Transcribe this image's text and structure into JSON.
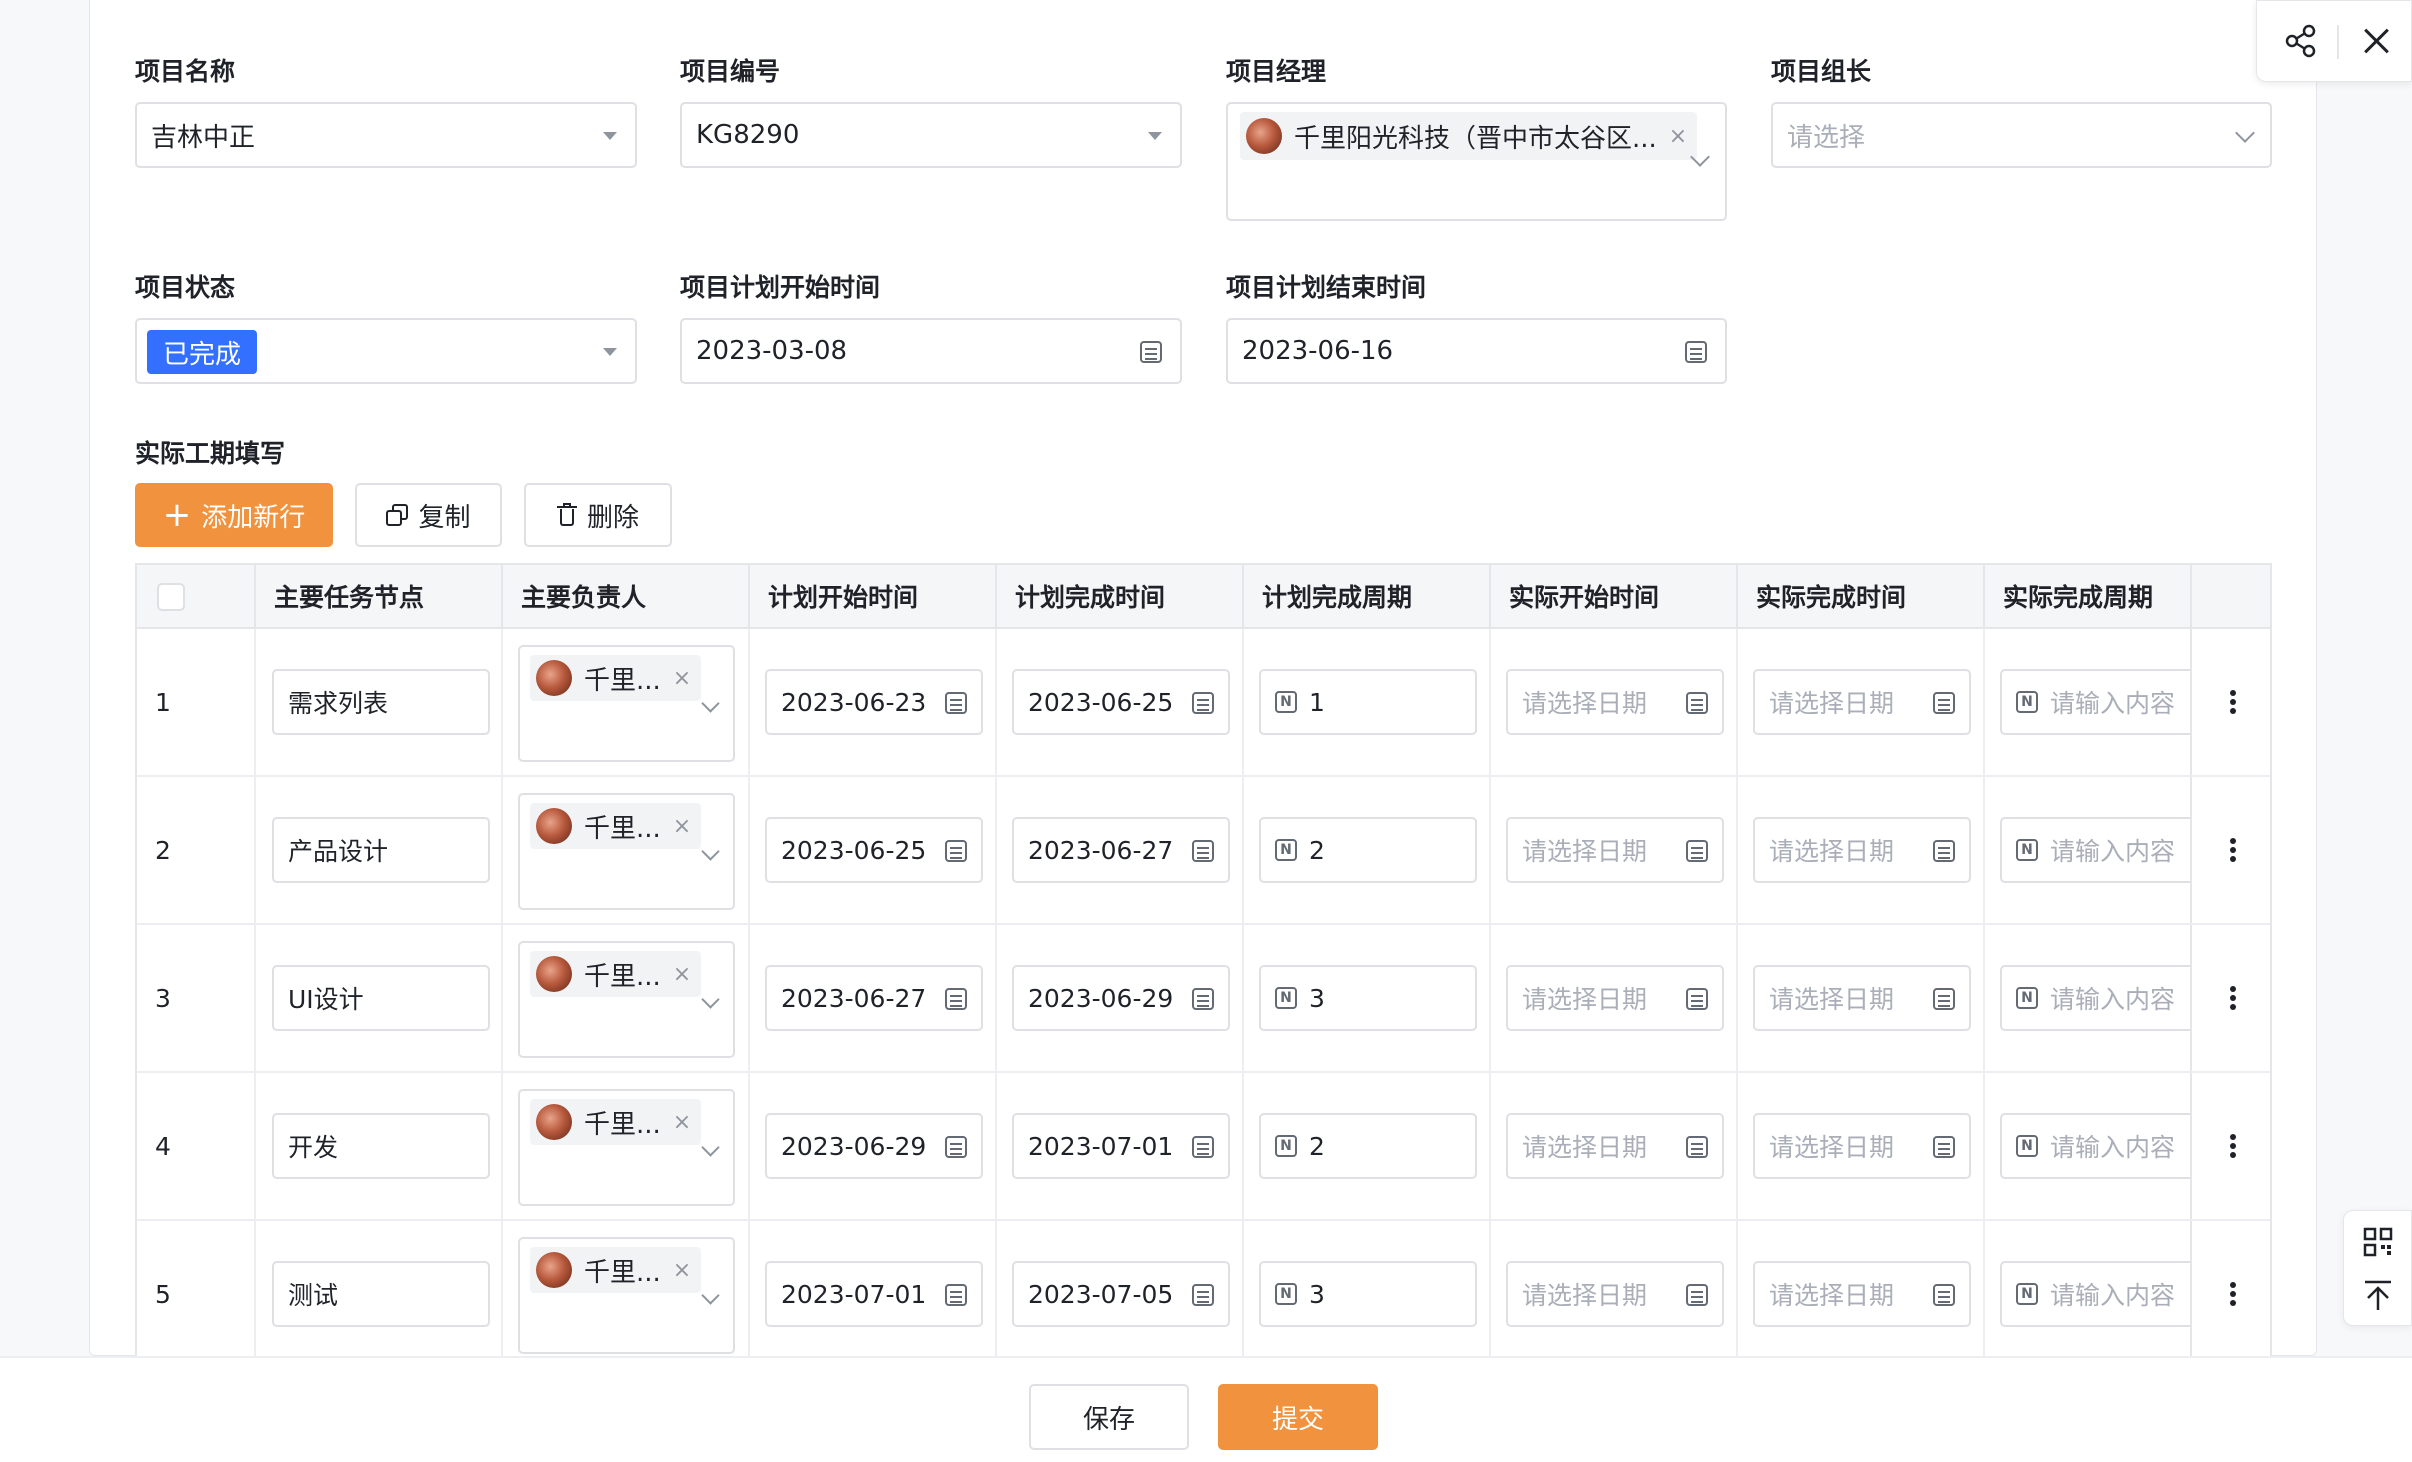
{
  "form": {
    "project_name": {
      "label": "项目名称",
      "value": "吉林中正"
    },
    "project_code": {
      "label": "项目编号",
      "value": "KG8290"
    },
    "project_manager": {
      "label": "项目经理",
      "value": "千里阳光科技（晋中市太谷区..."
    },
    "project_leader": {
      "label": "项目组长",
      "placeholder": "请选择"
    },
    "project_status": {
      "label": "项目状态",
      "value": "已完成"
    },
    "plan_start": {
      "label": "项目计划开始时间",
      "value": "2023-03-08"
    },
    "plan_end": {
      "label": "项目计划结束时间",
      "value": "2023-06-16"
    }
  },
  "section": {
    "title": "实际工期填写"
  },
  "toolbar": {
    "add_label": "添加新行",
    "copy_label": "复制",
    "delete_label": "删除"
  },
  "table": {
    "headers": [
      "主要任务节点",
      "主要负责人",
      "计划开始时间",
      "计划完成时间",
      "计划完成周期",
      "实际开始时间",
      "实际完成时间",
      "实际完成周期"
    ],
    "date_placeholder": "请选择日期",
    "input_placeholder": "请输入内容",
    "owner_short": "千里...",
    "rows": [
      {
        "index": "1",
        "task": "需求列表",
        "plan_start": "2023-06-23",
        "plan_end": "2023-06-25",
        "period": "1"
      },
      {
        "index": "2",
        "task": "产品设计",
        "plan_start": "2023-06-25",
        "plan_end": "2023-06-27",
        "period": "2"
      },
      {
        "index": "3",
        "task": "UI设计",
        "plan_start": "2023-06-27",
        "plan_end": "2023-06-29",
        "period": "3"
      },
      {
        "index": "4",
        "task": "开发",
        "plan_start": "2023-06-29",
        "plan_end": "2023-07-01",
        "period": "2"
      },
      {
        "index": "5",
        "task": "测试",
        "plan_start": "2023-07-01",
        "plan_end": "2023-07-05",
        "period": "3"
      }
    ]
  },
  "footer": {
    "save_label": "保存",
    "submit_label": "提交"
  },
  "icons": {
    "share": "share-icon",
    "close": "close-icon",
    "qrcode": "qrcode-icon",
    "back_top": "back-to-top-icon",
    "calendar": "calendar-icon",
    "number": "number-icon",
    "more": "more-vertical-icon"
  },
  "colors": {
    "accent": "#f0923e",
    "status_blue": "#3370ff"
  }
}
